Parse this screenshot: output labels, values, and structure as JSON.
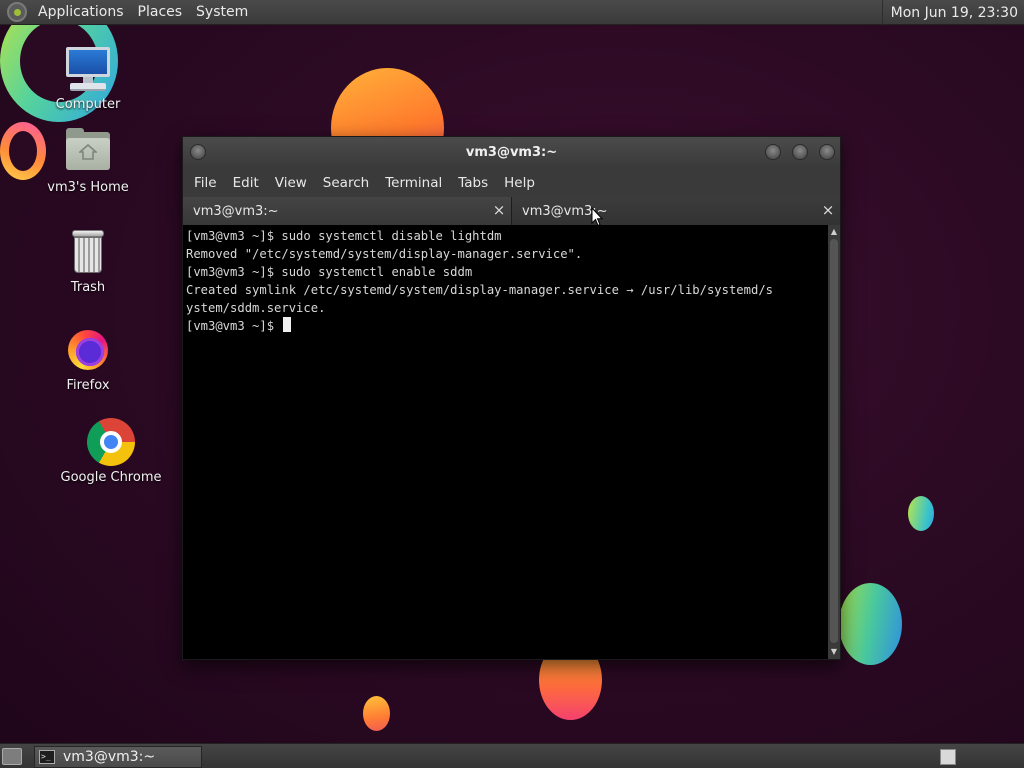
{
  "top_panel": {
    "menus": [
      "Applications",
      "Places",
      "System"
    ],
    "clock": "Mon Jun 19, 23:30"
  },
  "desktop_icons": [
    {
      "label": "Computer",
      "icon": "computer-icon"
    },
    {
      "label": "vm3's Home",
      "icon": "home-folder-icon"
    },
    {
      "label": "Trash",
      "icon": "trash-icon"
    },
    {
      "label": "Firefox",
      "icon": "firefox-icon"
    },
    {
      "label": "Google Chrome",
      "icon": "chrome-icon"
    }
  ],
  "terminal": {
    "title": "vm3@vm3:~",
    "menu": [
      "File",
      "Edit",
      "View",
      "Search",
      "Terminal",
      "Tabs",
      "Help"
    ],
    "tabs": [
      {
        "label": "vm3@vm3:~",
        "close": "×"
      },
      {
        "label": "vm3@vm3:~",
        "close": "×"
      }
    ],
    "lines": [
      "[vm3@vm3 ~]$ sudo systemctl disable lightdm",
      "Removed \"/etc/systemd/system/display-manager.service\".",
      "[vm3@vm3 ~]$ sudo systemctl enable sddm",
      "Created symlink /etc/systemd/system/display-manager.service → /usr/lib/systemd/s",
      "ystem/sddm.service.",
      "[vm3@vm3 ~]$ "
    ]
  },
  "taskbar": {
    "task_label": "vm3@vm3:~"
  },
  "colors": {
    "desktop_bg": "#2a0922",
    "panel_bg": "#3a3a3a",
    "terminal_bg": "#000000",
    "terminal_fg": "#d8d8d8"
  }
}
